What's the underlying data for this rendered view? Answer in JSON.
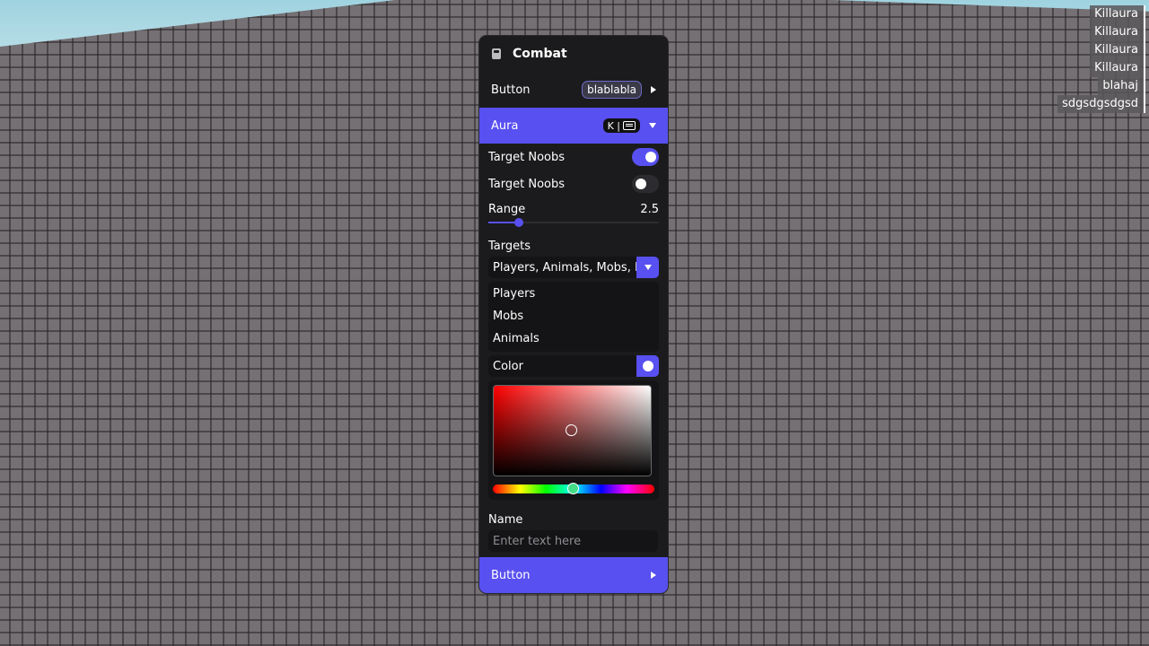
{
  "notifications": [
    "Killaura",
    "Killaura",
    "Killaura",
    "Killaura",
    "blahaj",
    "sdgsdgsdgsd"
  ],
  "window": {
    "title": "Combat",
    "icon": "gear-module-icon"
  },
  "button_row": {
    "label": "Button",
    "pill": "blablabla"
  },
  "aura_row": {
    "label": "Aura",
    "keybind": "K |"
  },
  "toggles": [
    {
      "label": "Target Noobs",
      "on": true
    },
    {
      "label": "Target Noobs",
      "on": false
    }
  ],
  "range": {
    "label": "Range",
    "value": "2.5",
    "fraction": 0.18
  },
  "targets": {
    "label": "Targets",
    "value": "Players, Animals, Mobs, I",
    "options": [
      "Players",
      "Mobs",
      "Animals"
    ]
  },
  "color": {
    "label": "Color",
    "base_hue": "#ff0000",
    "hue_marker_color": "#44dd88"
  },
  "name_field": {
    "label": "Name",
    "placeholder": "Enter text here",
    "value": ""
  },
  "bottom_button": {
    "label": "Button"
  },
  "colors": {
    "accent": "#5850f0",
    "panel": "#1b1b1d",
    "field": "#141416"
  }
}
